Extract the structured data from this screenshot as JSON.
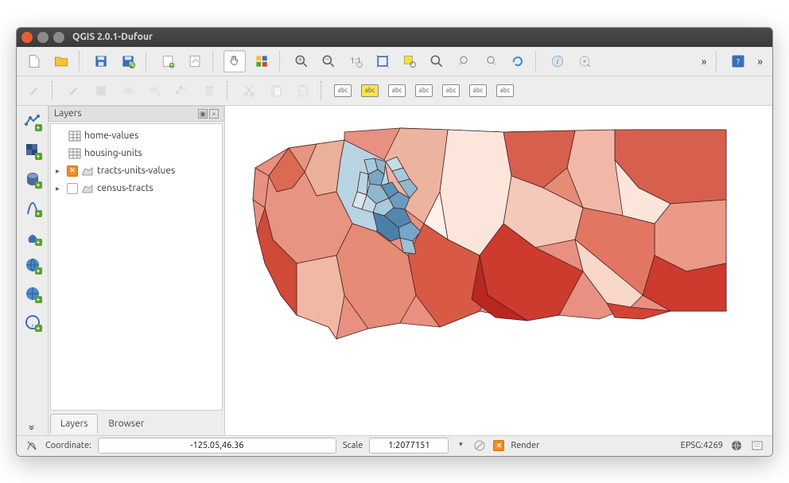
{
  "window": {
    "title": "QGIS 2.0.1-Dufour"
  },
  "panel": {
    "title": "Layers",
    "layers": [
      {
        "name": "home-values",
        "type": "table",
        "checked": null,
        "expandable": false
      },
      {
        "name": "housing-units",
        "type": "table",
        "checked": null,
        "expandable": false
      },
      {
        "name": "tracts-units-values",
        "type": "polygon",
        "checked": true,
        "expandable": true
      },
      {
        "name": "census-tracts",
        "type": "polygon",
        "checked": false,
        "expandable": true
      }
    ]
  },
  "tabs": {
    "active": "Layers",
    "other": "Browser"
  },
  "status": {
    "coord_label": "Coordinate:",
    "coord_value": "-125.05,46.36",
    "scale_label": "Scale",
    "scale_value": "1:2077151",
    "render_label": "Render",
    "render_checked": true,
    "crs": "EPSG:4269"
  },
  "toolbar_icons": {
    "row1": [
      "new-project",
      "open-project",
      "save-project",
      "save-as",
      "new-print-composer",
      "composer-manager",
      "pan",
      "pan-to-selection",
      "zoom-in",
      "zoom-out",
      "zoom-native",
      "zoom-full",
      "zoom-selection",
      "zoom-layer",
      "zoom-last",
      "zoom-next",
      "refresh",
      "identify",
      "run-feature-action"
    ],
    "row2": [
      "edit-toggle",
      "edit-current",
      "save-edits",
      "add-feature",
      "move-feature",
      "node-tool",
      "delete-selected",
      "cut",
      "copy",
      "paste",
      "label-abc",
      "label-highlight",
      "label-pin",
      "label-show",
      "label-move",
      "label-rotate",
      "label-change"
    ]
  },
  "left_tools": [
    "add-vector",
    "add-raster",
    "add-postgis",
    "add-spatialite",
    "add-wms",
    "add-wcs",
    "add-wfs",
    "add-delimited"
  ],
  "abc": "abc"
}
